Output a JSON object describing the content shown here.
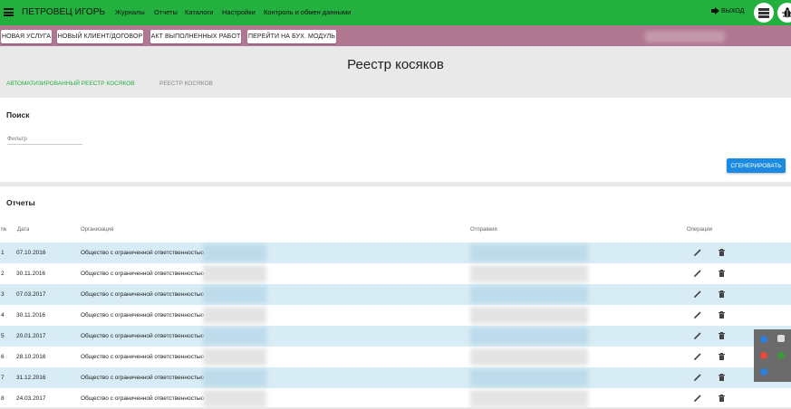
{
  "header": {
    "user_name": "ПЕТРОВЕЦ ИГОРЬ",
    "nav": [
      "Журналы",
      "Отчеты",
      "Каталоги",
      "Настройки",
      "Контроль и обмен данными"
    ],
    "exit_label": "ВЫХОД",
    "icons": [
      "menu-icon",
      "exit-icon",
      "list-icon",
      "bug-icon"
    ],
    "colors": {
      "topbar": "#23b03f",
      "actionbar": "#b07791",
      "accent": "#1a8be0",
      "tab_active": "#23b03f"
    }
  },
  "actions": [
    "НОВАЯ УСЛУГА",
    "НОВЫЙ КЛИЕНТ/ДОГОВОР",
    "АКТ ВЫПОЛНЕННЫХ РАБОТ",
    "ПЕРЕЙТИ НА БУХ. МОДУЛЬ"
  ],
  "page_title": "Реестр косяков",
  "tabs": [
    {
      "label": "АВТОМАТИЗИРОВАННЫЙ РЕЕСТР КОСЯКОВ",
      "active": true
    },
    {
      "label": "РЕЕСТР КОСЯКОВ",
      "active": false
    }
  ],
  "search": {
    "title": "Поиск",
    "filter_placeholder": "Фильтр",
    "generate_label": "СГЕНЕРИРОВАТЬ"
  },
  "reports": {
    "title": "Отчеты",
    "columns": [
      "№",
      "Дата",
      "Организация",
      "Отправкия",
      "Операции"
    ],
    "rows": [
      {
        "n": "1",
        "date": "07.10.2016",
        "org": "Общество с ограниченной ответственностью"
      },
      {
        "n": "2",
        "date": "30.11.2016",
        "org": "Общество с ограниченной ответственностью"
      },
      {
        "n": "3",
        "date": "07.03.2017",
        "org": "Общество с ограниченной ответственностью"
      },
      {
        "n": "4",
        "date": "30.11.2016",
        "org": "Общество с ограниченной ответственностью"
      },
      {
        "n": "5",
        "date": "20.01.2017",
        "org": "Общество с ограниченной ответственностью"
      },
      {
        "n": "6",
        "date": "28.10.2016",
        "org": "Общество с ограниченной ответственностью"
      },
      {
        "n": "7",
        "date": "31.12.2016",
        "org": "Общество с ограниченной ответственностью"
      },
      {
        "n": "8",
        "date": "24.03.2017",
        "org": "Общество с ограниченной ответственностью"
      }
    ],
    "row_icons": [
      "edit-icon",
      "delete-icon"
    ]
  }
}
